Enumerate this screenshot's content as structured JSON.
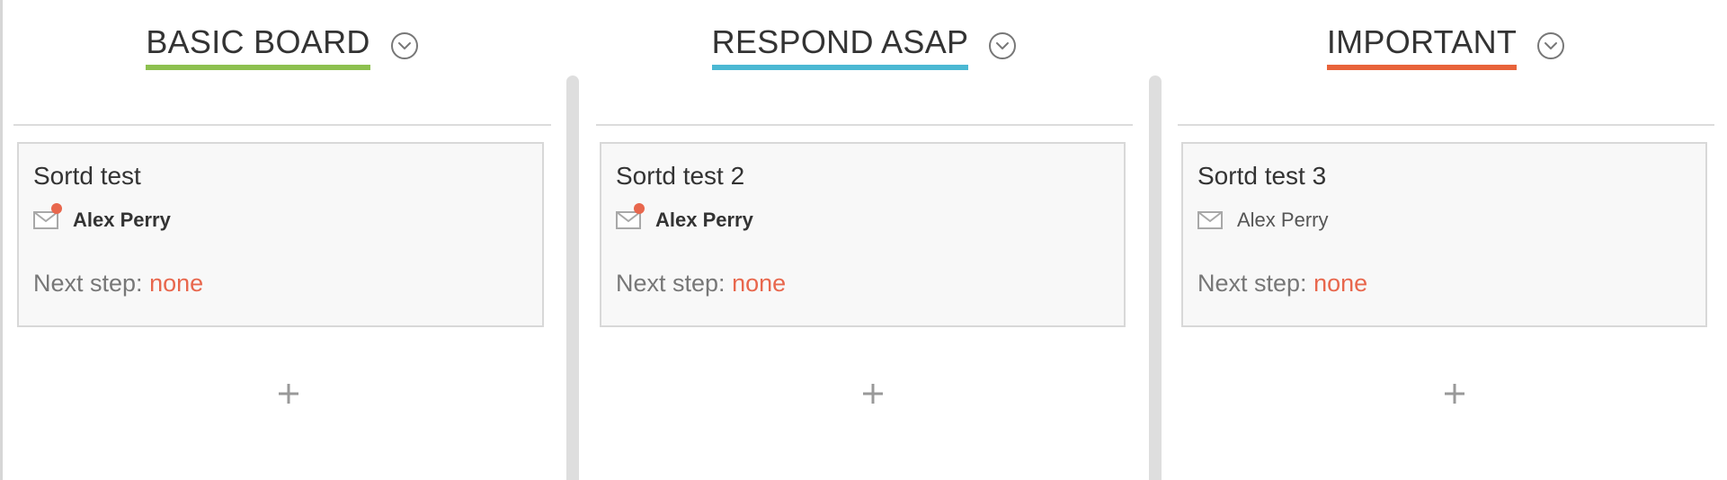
{
  "colors": {
    "accent_green": "#8dc04f",
    "accent_blue": "#4bb8d3",
    "accent_orange": "#e8633a",
    "next_step_value": "#e8674d",
    "unread_dot": "#e8674d"
  },
  "columns": [
    {
      "title": "BASIC BOARD",
      "underline_color": "#8dc04f",
      "menu_icon": "chevron-down-circle-icon",
      "add_icon": "plus-icon",
      "card": {
        "title": "Sortd test",
        "contact_icon": "mail-icon",
        "unread": true,
        "contact_name": "Alex Perry",
        "next_step_label": "Next step:",
        "next_step_value": "none"
      }
    },
    {
      "title": "RESPOND ASAP",
      "underline_color": "#4bb8d3",
      "menu_icon": "chevron-down-circle-icon",
      "add_icon": "plus-icon",
      "card": {
        "title": "Sortd test 2",
        "contact_icon": "mail-icon",
        "unread": true,
        "contact_name": "Alex Perry",
        "next_step_label": "Next step:",
        "next_step_value": "none"
      }
    },
    {
      "title": "IMPORTANT",
      "underline_color": "#e8633a",
      "menu_icon": "chevron-down-circle-icon",
      "add_icon": "plus-icon",
      "card": {
        "title": "Sortd test 3",
        "contact_icon": "mail-icon",
        "unread": false,
        "contact_name": "Alex Perry",
        "next_step_label": "Next step:",
        "next_step_value": "none"
      }
    }
  ]
}
